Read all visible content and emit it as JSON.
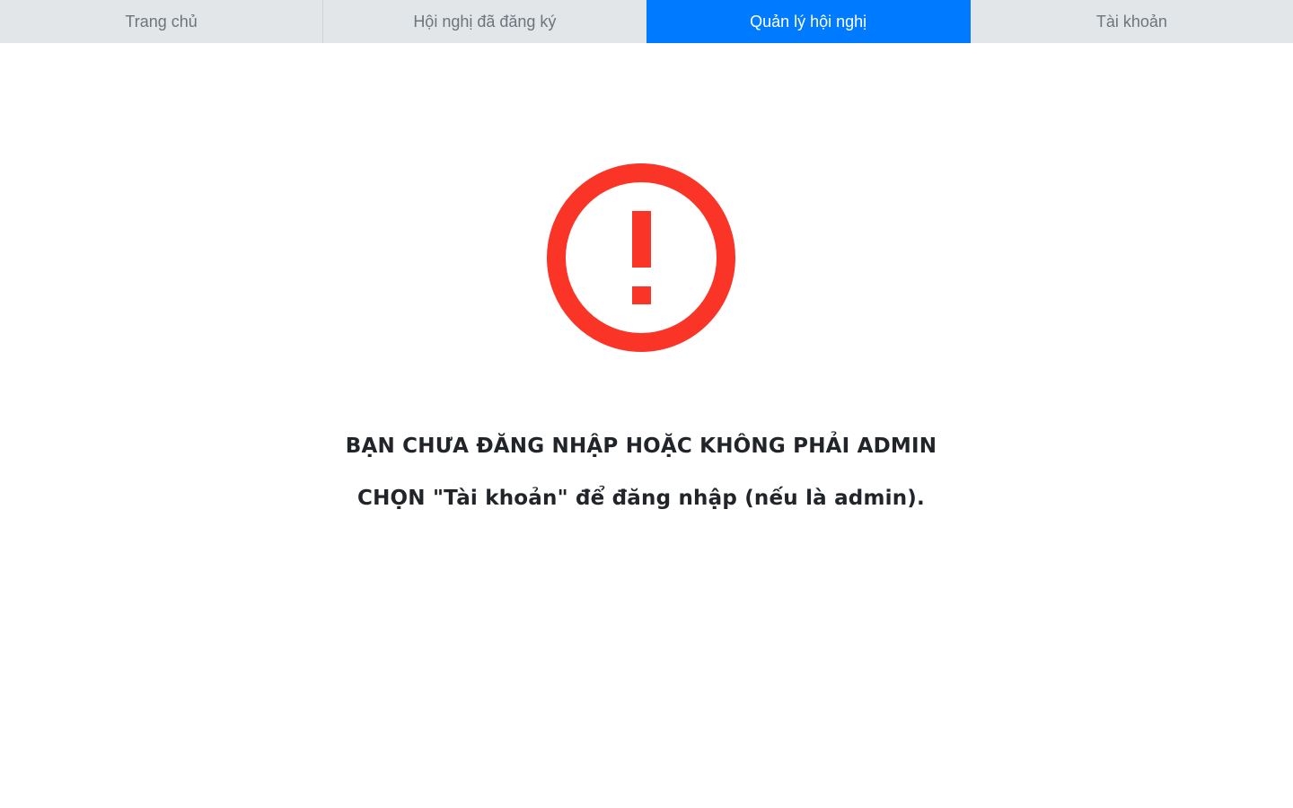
{
  "nav": {
    "tabs": [
      {
        "label": "Trang chủ",
        "active": false
      },
      {
        "label": "Hội nghị đã đăng ký",
        "active": false
      },
      {
        "label": "Quản lý hội nghị",
        "active": true
      },
      {
        "label": "Tài khoản",
        "active": false
      }
    ]
  },
  "main": {
    "icon": "alert-circle-icon",
    "message_line1": "BẠN CHƯA ĐĂNG NHẬP HOẶC KHÔNG PHẢI ADMIN",
    "message_line2": "CHỌN \"Tài khoản\" để đăng nhập (nếu là admin)."
  },
  "colors": {
    "accent": "#007bff",
    "nav_background": "#e3e6e9",
    "alert": "#fa3427",
    "text": "#212529"
  }
}
